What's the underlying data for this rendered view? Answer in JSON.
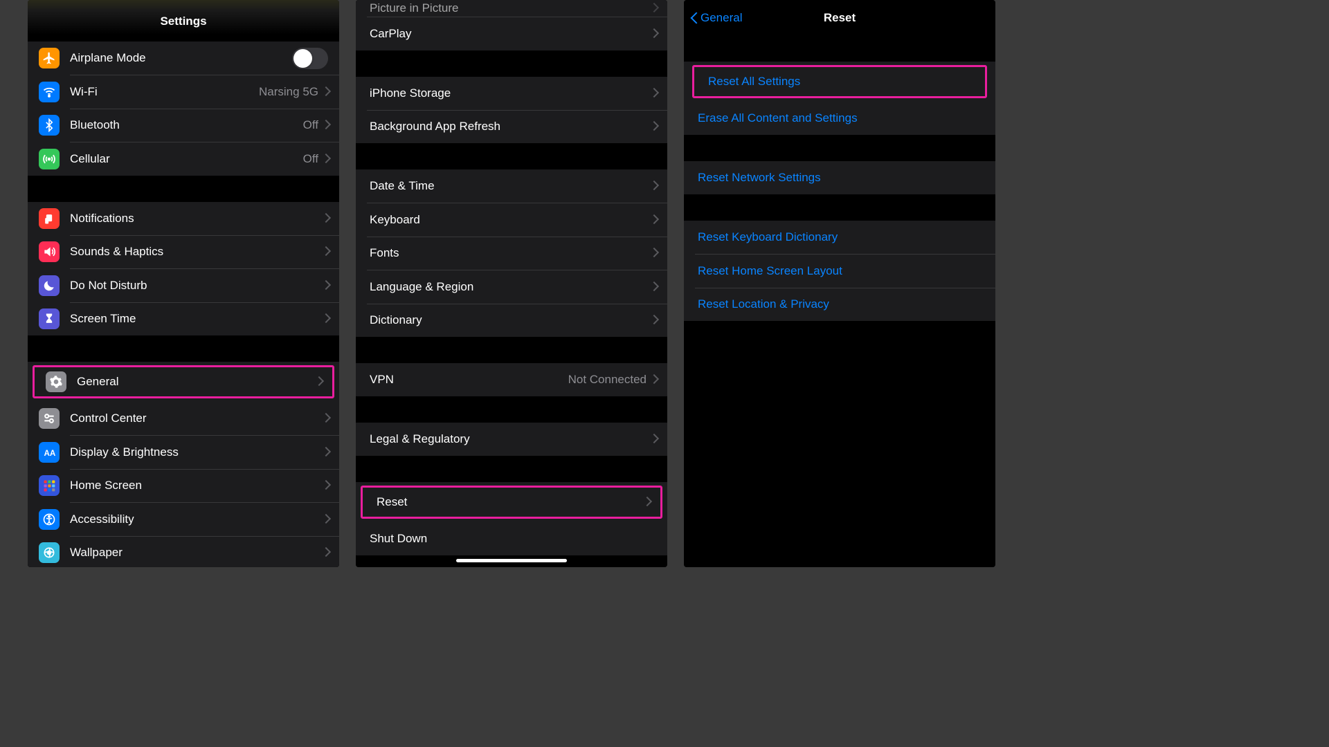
{
  "phone1": {
    "title": "Settings",
    "groups": [
      {
        "items": [
          {
            "icon": "airplane",
            "color": "#ff9500",
            "label": "Airplane Mode",
            "toggle": true
          },
          {
            "icon": "wifi",
            "color": "#007aff",
            "label": "Wi-Fi",
            "value": "Narsing 5G",
            "chevron": true
          },
          {
            "icon": "bluetooth",
            "color": "#007aff",
            "label": "Bluetooth",
            "value": "Off",
            "chevron": true
          },
          {
            "icon": "cellular",
            "color": "#34c759",
            "label": "Cellular",
            "value": "Off",
            "chevron": true
          }
        ]
      },
      {
        "items": [
          {
            "icon": "bell",
            "color": "#ff3b30",
            "label": "Notifications",
            "chevron": true
          },
          {
            "icon": "speaker",
            "color": "#ff3b30",
            "label": "Sounds & Haptics",
            "chevron": true
          },
          {
            "icon": "moon",
            "color": "#5856d6",
            "label": "Do Not Disturb",
            "chevron": true
          },
          {
            "icon": "hourglass",
            "color": "#5856d6",
            "label": "Screen Time",
            "chevron": true
          }
        ]
      },
      {
        "items": [
          {
            "icon": "gear",
            "color": "#8e8e93",
            "label": "General",
            "chevron": true,
            "highlight": true
          },
          {
            "icon": "control",
            "color": "#8e8e93",
            "label": "Control Center",
            "chevron": true
          },
          {
            "icon": "display",
            "color": "#007aff",
            "label": "Display & Brightness",
            "chevron": true
          },
          {
            "icon": "grid",
            "color": "#3355dd",
            "label": "Home Screen",
            "chevron": true
          },
          {
            "icon": "accessibility",
            "color": "#007aff",
            "label": "Accessibility",
            "chevron": true
          },
          {
            "icon": "wallpaper",
            "color": "#33bbdd",
            "label": "Wallpaper",
            "chevron": true
          }
        ]
      }
    ]
  },
  "phone2": {
    "pip_label": "Picture in Picture",
    "groups": [
      {
        "partial_top": true,
        "items": [
          {
            "label": "CarPlay"
          }
        ]
      },
      {
        "items": [
          {
            "label": "iPhone Storage"
          },
          {
            "label": "Background App Refresh"
          }
        ]
      },
      {
        "items": [
          {
            "label": "Date & Time"
          },
          {
            "label": "Keyboard"
          },
          {
            "label": "Fonts"
          },
          {
            "label": "Language & Region"
          },
          {
            "label": "Dictionary"
          }
        ]
      },
      {
        "items": [
          {
            "label": "VPN",
            "value": "Not Connected"
          }
        ]
      },
      {
        "items": [
          {
            "label": "Legal & Regulatory"
          }
        ]
      },
      {
        "items": [
          {
            "label": "Reset",
            "highlight": true
          },
          {
            "label": "Shut Down",
            "link": true,
            "no_chevron": true
          }
        ]
      }
    ]
  },
  "phone3": {
    "back": "General",
    "title": "Reset",
    "groups": [
      {
        "items": [
          {
            "label": "Reset All Settings",
            "highlight": true
          },
          {
            "label": "Erase All Content and Settings"
          }
        ]
      },
      {
        "items": [
          {
            "label": "Reset Network Settings"
          }
        ]
      },
      {
        "items": [
          {
            "label": "Reset Keyboard Dictionary"
          },
          {
            "label": "Reset Home Screen Layout"
          },
          {
            "label": "Reset Location & Privacy"
          }
        ]
      }
    ]
  }
}
